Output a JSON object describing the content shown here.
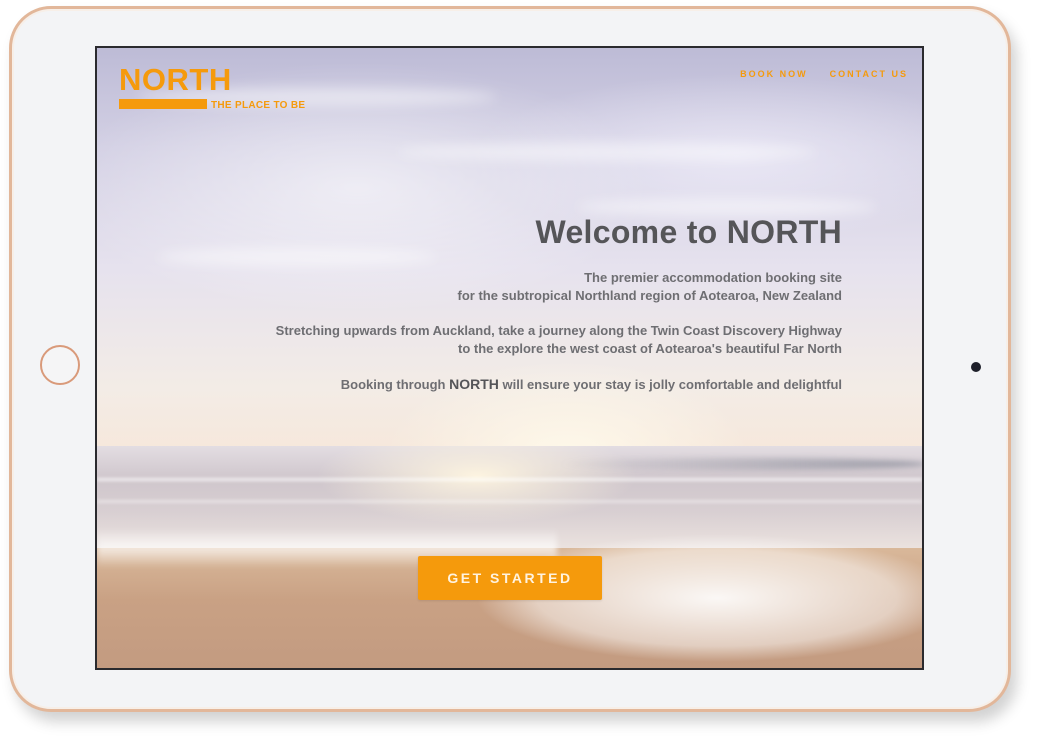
{
  "brand": {
    "name": "NORTH",
    "tagline": "THE PLACE TO BE",
    "accent_color": "#f59a0c"
  },
  "nav": {
    "items": [
      {
        "label": "BOOK NOW"
      },
      {
        "label": "CONTACT US"
      }
    ]
  },
  "hero": {
    "title": "Welcome to NORTH",
    "paragraph1": {
      "line1": "The premier accommodation booking site",
      "line2": "for the subtropical Northland region of Aotearoa, New Zealand"
    },
    "paragraph2": {
      "line1": "Stretching upwards from Auckland, take a journey along the Twin Coast Discovery Highway",
      "line2": "to the explore the west coast of Aotearoa's beautiful Far North"
    },
    "paragraph3": {
      "before": "Booking through ",
      "brand": "NORTH",
      "after": " will ensure your stay is jolly comfortable and delightful"
    },
    "cta_label": "GET STARTED"
  },
  "device": {
    "type": "tablet",
    "frame_color": "#e2b79a"
  }
}
